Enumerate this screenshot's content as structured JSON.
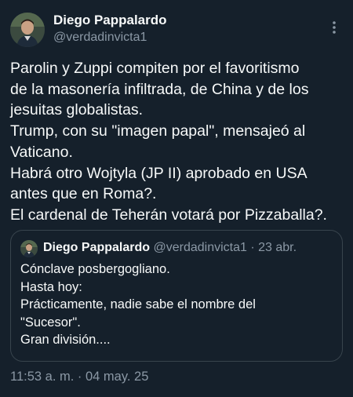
{
  "tweet": {
    "author": {
      "display_name": "Diego Pappalardo",
      "handle": "@verdadinvicta1"
    },
    "body_lines": [
      "Parolin y  Zuppi compiten por el favoritismo",
      "de la masonería infiltrada,  de China y de los",
      "jesuitas globalistas.",
      "Trump, con su \"imagen papal\", mensajeó al",
      "Vaticano.",
      "Habrá otro Wojtyla (JP II) aprobado en USA",
      "antes que en Roma?.",
      "El cardenal de Teherán votará por Pizzaballa?."
    ],
    "quoted": {
      "display_name": "Diego Pappalardo",
      "handle": "@verdadinvicta1",
      "separator": " · ",
      "date": "23 abr.",
      "lines": [
        "Cónclave posbergogliano.",
        "Hasta hoy:",
        "Prácticamente, nadie sabe el nombre del",
        "\"Sucesor\".",
        "Gran división...."
      ]
    },
    "timestamp": "11:53 a. m. · 04 may. 25"
  },
  "icons": {
    "more": "more-vertical-icon",
    "avatar": "profile-photo"
  },
  "colors": {
    "background": "#15202b",
    "text_primary": "#f7f9f9",
    "text_secondary": "#8b98a5",
    "border": "#38444d"
  }
}
